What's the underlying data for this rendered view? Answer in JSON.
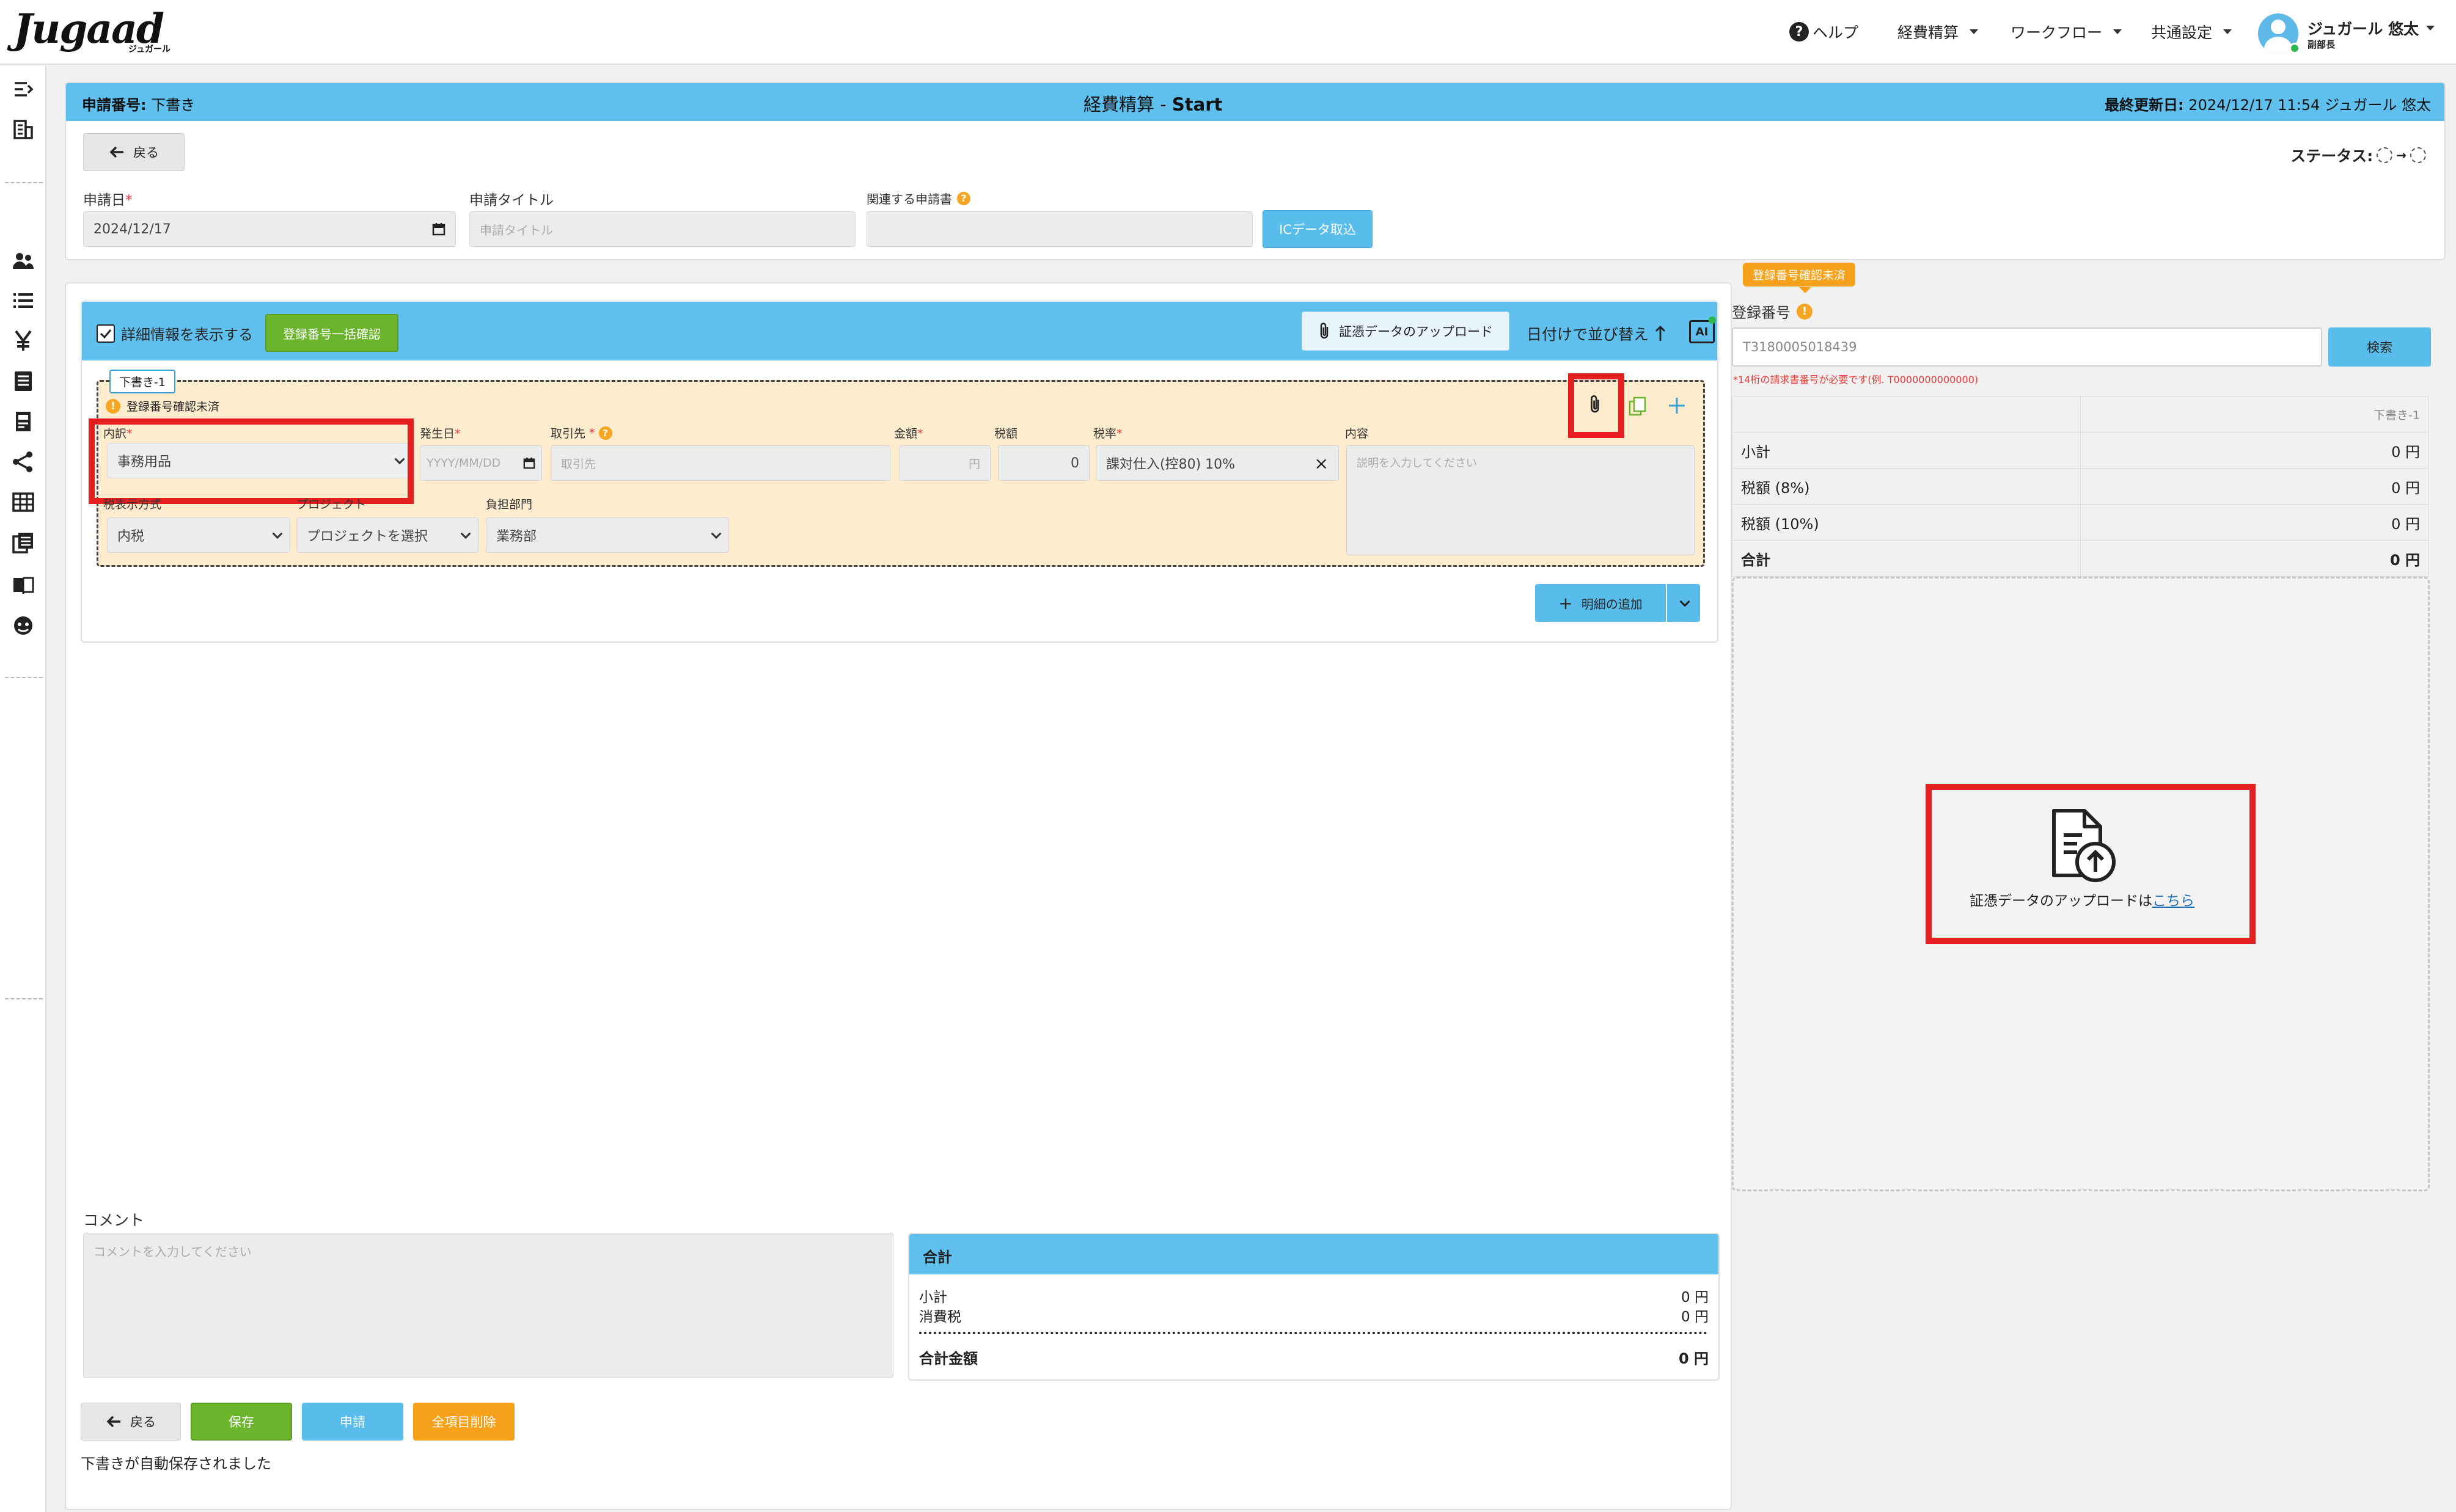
{
  "header": {
    "brand": "Jugaad",
    "brand_sub": "ジュガール",
    "nav": {
      "help": "ヘルプ",
      "expense": "経費精算",
      "workflow": "ワークフロー",
      "common": "共通設定"
    },
    "user": {
      "name": "ジュガール 悠太",
      "role": "副部長"
    }
  },
  "request": {
    "number_label": "申請番号:",
    "number_value": "下書き",
    "title": "経費精算 - ",
    "title_bold": "Start",
    "last_updated_label": "最終更新日:",
    "last_updated_value": "2024/12/17 11:54 ジュガール 悠太",
    "back": "戻る",
    "status_label": "ステータス:",
    "date_label": "申請日",
    "date_value": "2024/12/17",
    "title_label": "申請タイトル",
    "title_placeholder": "申請タイトル",
    "related_label": "関連する申請書",
    "ic_button": "ICデータ取込"
  },
  "detail": {
    "show_details": "詳細情報を表示する",
    "bulk_confirm": "登録番号一括確認",
    "upload_button": "証憑データのアップロード",
    "sort_label": "日付けで並び替え",
    "ai_label": "AI",
    "draft_tag": "下書き-1",
    "warning_text": "登録番号確認未済",
    "fields": {
      "category_label": "内訳",
      "category_value": "事務用品",
      "date_label": "発生日",
      "date_placeholder": "YYYY/MM/DD",
      "partner_label": "取引先",
      "partner_placeholder": "取引先",
      "amount_label": "金額",
      "amount_unit": "円",
      "tax_label": "税額",
      "tax_value": "0",
      "rate_label": "税率",
      "rate_value": "課対仕入(控80) 10%",
      "content_label": "内容",
      "content_placeholder": "説明を入力してください",
      "tax_type_label": "税表示方式",
      "tax_type_value": "内税",
      "project_label": "プロジェクト",
      "project_value": "プロジェクトを選択",
      "dept_label": "負担部門",
      "dept_value": "業務部"
    },
    "add_line": "明細の追加"
  },
  "comment": {
    "label": "コメント",
    "placeholder": "コメントを入力してください"
  },
  "summary": {
    "title": "合計",
    "subtotal": "小計",
    "subtotal_value": "0 円",
    "tax": "消費税",
    "tax_value": "0 円",
    "total": "合計金額",
    "total_value": "0 円"
  },
  "footer": {
    "back": "戻る",
    "save": "保存",
    "apply": "申請",
    "delete_all": "全項目削除",
    "autosave": "下書きが自動保存されました"
  },
  "right_panel": {
    "badge": "登録番号確認未済",
    "reg_label": "登録番号",
    "reg_value": "T3180005018439",
    "search": "検索",
    "hint": "*14桁の請求書番号が必要です(例. T0000000000000)",
    "col_header": "下書き-1",
    "rows": [
      {
        "label": "小計",
        "value": "0 円"
      },
      {
        "label": "税額 (8%)",
        "value": "0 円"
      },
      {
        "label": "税額 (10%)",
        "value": "0 円"
      },
      {
        "label": "合計",
        "value": "0 円"
      }
    ],
    "upload_text": "証憑データのアップロードは",
    "upload_link": "こちら"
  },
  "colors": {
    "accent_blue": "#5fc0ee",
    "green": "#6bb52d",
    "orange": "#f6a11a",
    "highlight_red": "#e41f1f",
    "draft_bg": "#fdeccd"
  }
}
